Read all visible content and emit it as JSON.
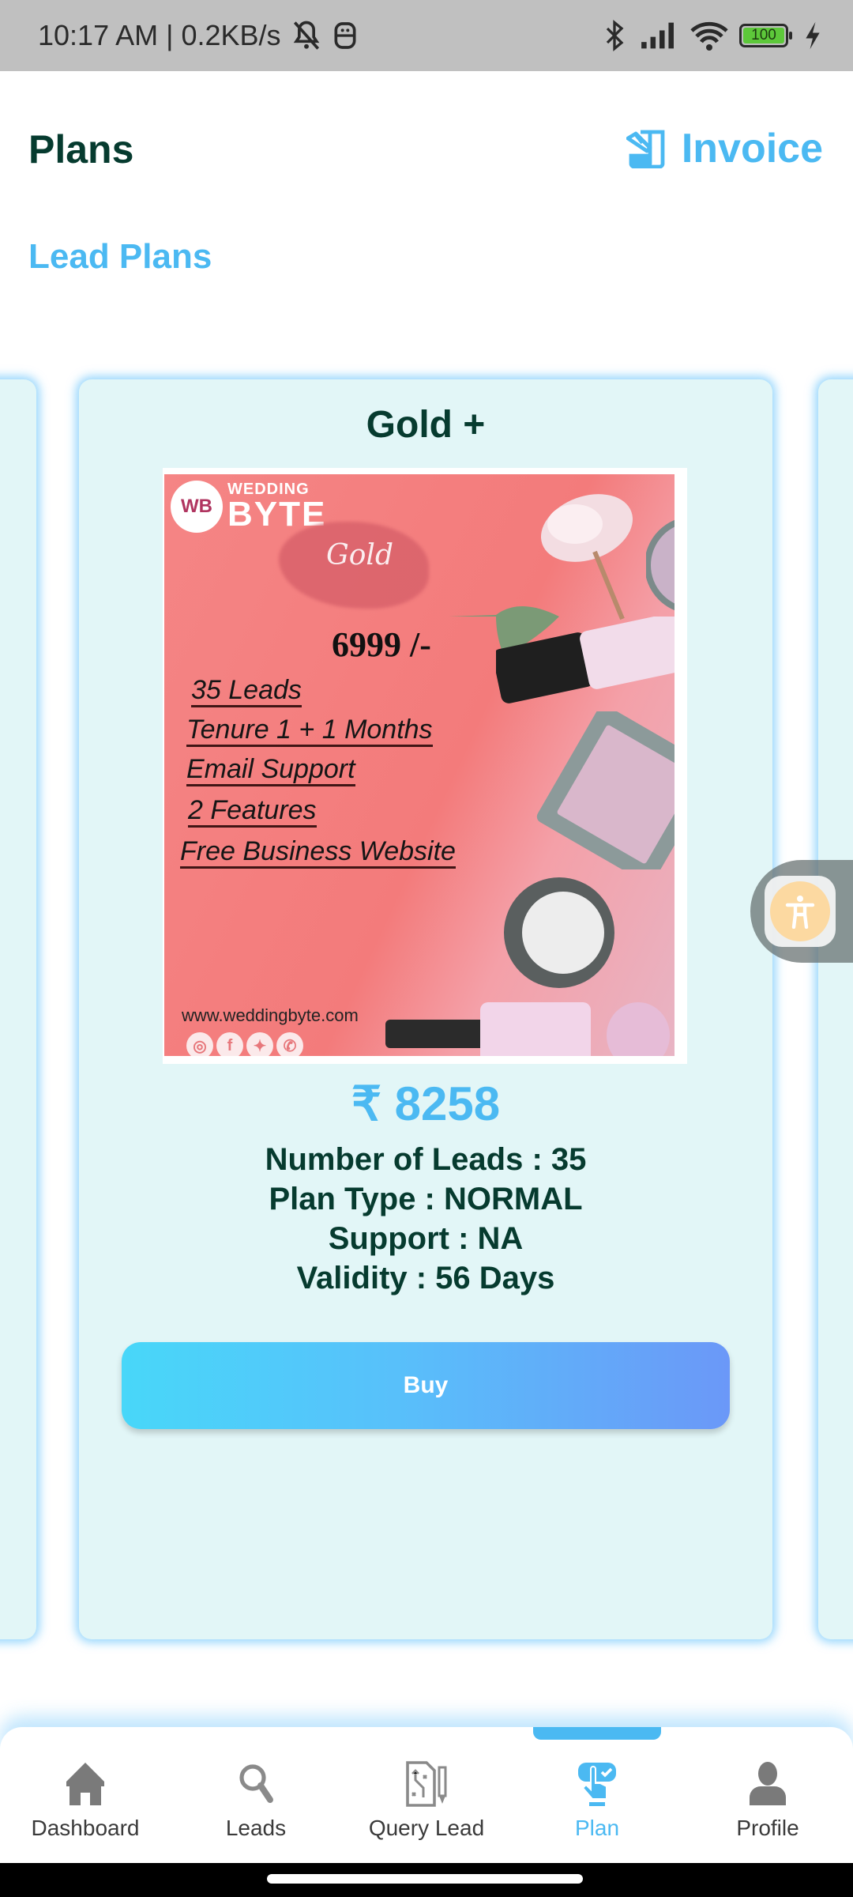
{
  "status_bar": {
    "time": "10:17 AM",
    "network_speed": "0.2KB/s",
    "separator": "|",
    "battery_level": "100",
    "icons": [
      "mute-bell-icon",
      "sim-icon",
      "bluetooth-icon",
      "signal-icon",
      "wifi-icon",
      "battery-icon",
      "charging-icon"
    ]
  },
  "header": {
    "title": "Plans",
    "invoice_label": "Invoice",
    "invoice_icon": "invoice-icon"
  },
  "section": {
    "title": "Lead Plans"
  },
  "plan_card": {
    "title": "Gold +",
    "image": {
      "brand_initials": "WB",
      "brand_top": "WEDDING",
      "brand_bottom": "BYTE",
      "tier": "Gold",
      "price": "6999 /-",
      "features": [
        "35 Leads",
        "Tenure 1 + 1 Months",
        "Email Support",
        "2 Features",
        "Free Business Website"
      ],
      "website": "www.weddingbyte.com",
      "socials": [
        "instagram-icon",
        "facebook-icon",
        "twitter-icon",
        "whatsapp-icon"
      ]
    },
    "price": "₹ 8258",
    "details": [
      "Number of Leads : 35",
      "Plan Type : NORMAL",
      "Support : NA",
      "Validity : 56 Days"
    ],
    "buy_label": "Buy"
  },
  "bottom_nav": {
    "items": [
      {
        "label": "Dashboard",
        "icon": "home-icon",
        "active": false
      },
      {
        "label": "Leads",
        "icon": "search-icon",
        "active": false
      },
      {
        "label": "Query Lead",
        "icon": "query-plan-icon",
        "active": false
      },
      {
        "label": "Plan",
        "icon": "plan-touch-icon",
        "active": true
      },
      {
        "label": "Profile",
        "icon": "user-icon",
        "active": false
      }
    ]
  },
  "colors": {
    "accent": "#4bb9f2",
    "title_dark": "#063b2f",
    "card_bg": "#e2f6f7",
    "buy_gradient_start": "#48d7f9",
    "buy_gradient_end": "#6b98f8"
  }
}
